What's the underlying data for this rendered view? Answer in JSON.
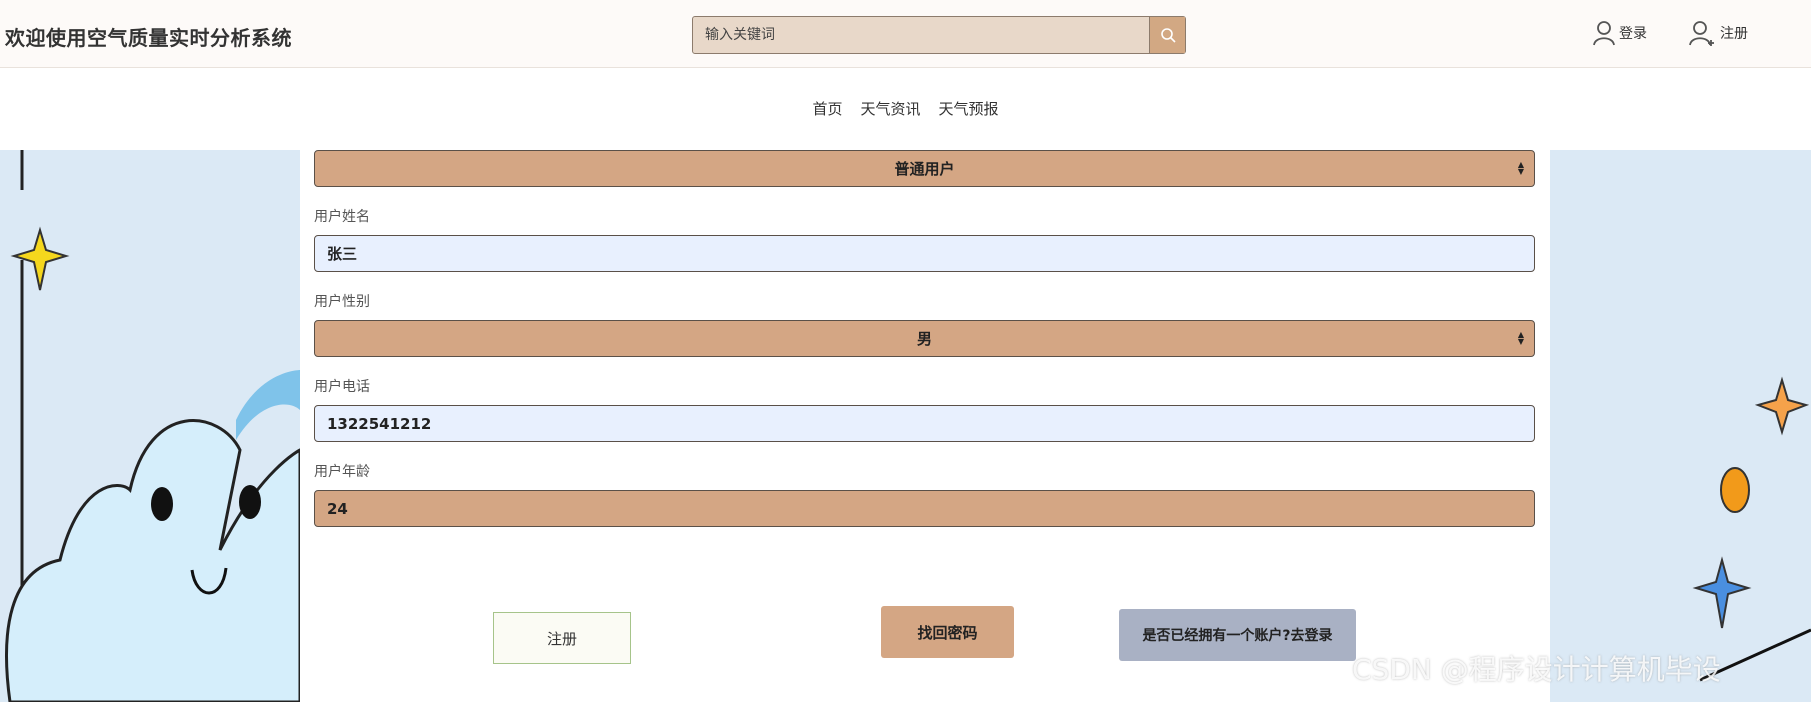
{
  "header": {
    "site_title": "欢迎使用空气质量实时分析系统",
    "search_placeholder": "输入关键词",
    "login_label": "登录",
    "register_label": "注册"
  },
  "nav": {
    "items": [
      "首页",
      "天气资讯",
      "天气预报"
    ]
  },
  "form": {
    "role_select_value": "普通用户",
    "name_label": "用户姓名",
    "name_value": "张三",
    "gender_label": "用户性别",
    "gender_value": "男",
    "phone_label": "用户电话",
    "phone_value": "1322541212",
    "age_label": "用户年龄",
    "age_value": "24"
  },
  "buttons": {
    "register": "注册",
    "recover_password": "找回密码",
    "have_account": "是否已经拥有一个账户?去登录"
  },
  "watermark": "CSDN @程序设计计算机毕设",
  "colors": {
    "accent_tan": "#d4a684",
    "input_blue": "#e8f0fe",
    "link_button": "#a9b1c4"
  }
}
